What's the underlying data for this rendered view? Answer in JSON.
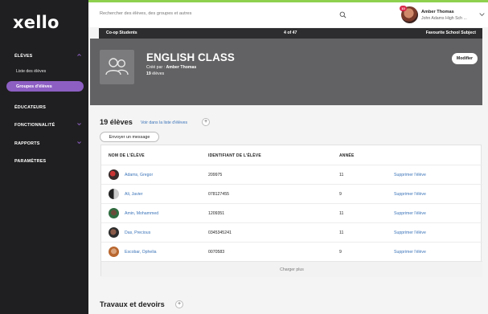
{
  "app": {
    "logo": "xello"
  },
  "sidebar": {
    "sections": [
      {
        "label": "ÉLÈVES",
        "expanded": true
      },
      {
        "label": "ÉDUCATEURS"
      },
      {
        "label": "FONCTIONNALITÉ"
      },
      {
        "label": "RAPPORTS"
      },
      {
        "label": "PARAMÈTRES"
      }
    ],
    "sub_items": [
      {
        "label": "Liste des élèves"
      },
      {
        "label": "Groupes d'élèves",
        "active": true
      }
    ]
  },
  "topbar": {
    "search_placeholder": "Rechercher des élèves, des groupes et autres",
    "user_name": "Amber Thomas",
    "user_school": "John Adams High Sch ...",
    "notification_count": "10"
  },
  "navigator": {
    "left": "Co-op Students",
    "position": "4 of 47",
    "right": "Favourite School Subject"
  },
  "class": {
    "title": "ENGLISH CLASS",
    "created_by_label": "Créé par :",
    "created_by": "Amber Thomas",
    "student_count": "19",
    "students_word": "élèves",
    "modify_label": "Modifier"
  },
  "students_section": {
    "title": "19 élèves",
    "view_list_link": "Voir dans la liste d'élèves",
    "message_button": "Envoyer un message",
    "columns": [
      "NOM DE L'ÉLÈVE",
      "IDENTIFIANT DE L'ÉLÈVE",
      "ANNÉE"
    ],
    "rows": [
      {
        "name": "Adams, Gregor",
        "id": "209975",
        "year": "11",
        "action": "Supprimer l'élève"
      },
      {
        "name": "Ali, Javier",
        "id": "078127455",
        "year": "9",
        "action": "Supprimer l'élève"
      },
      {
        "name": "Amin, Mohammed",
        "id": "1209351",
        "year": "11",
        "action": "Supprimer l'élève"
      },
      {
        "name": "Das, Precious",
        "id": "0345345241",
        "year": "11",
        "action": "Supprimer l'élève"
      },
      {
        "name": "Escobar, Ophelia",
        "id": "0070583",
        "year": "9",
        "action": "Supprimer l'élève"
      }
    ],
    "load_more": "Charger plus"
  },
  "works_section": {
    "title": "Travaux et devoirs"
  },
  "colors": {
    "sidebar_bg": "#1f1f21",
    "accent_purple": "#8d5fc3",
    "link_blue": "#3a73b8",
    "top_accent_green": "#8fd14f",
    "header_grey": "#626264"
  }
}
